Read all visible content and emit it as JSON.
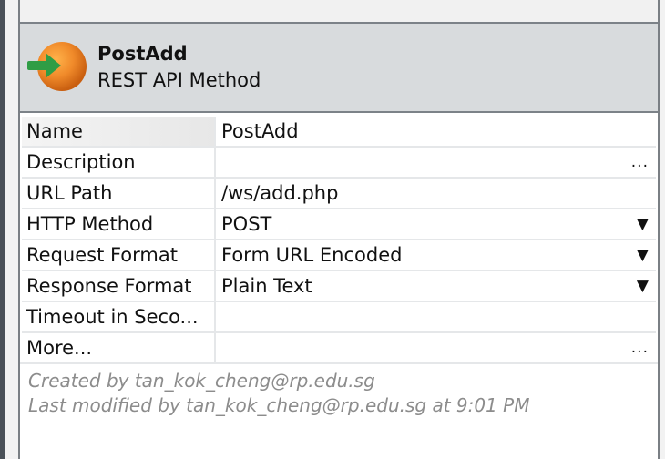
{
  "header": {
    "title": "PostAdd",
    "subtitle": "REST API Method",
    "icon": "rest-method-icon"
  },
  "properties": [
    {
      "name": "Name",
      "value": "PostAdd",
      "suffix": ""
    },
    {
      "name": "Description",
      "value": "",
      "suffix": "..."
    },
    {
      "name": "URL Path",
      "value": "/ws/add.php",
      "suffix": ""
    },
    {
      "name": "HTTP Method",
      "value": "POST",
      "suffix": "▼"
    },
    {
      "name": "Request Format",
      "value": "Form URL Encoded",
      "suffix": "▼"
    },
    {
      "name": "Response Format",
      "value": "Plain Text",
      "suffix": "▼"
    },
    {
      "name": "Timeout in Seco...",
      "value": "",
      "suffix": ""
    },
    {
      "name": "More...",
      "value": "",
      "suffix": "..."
    }
  ],
  "footer": {
    "created_by": "Created by tan_kok_cheng@rp.edu.sg",
    "modified_by": "Last modified by tan_kok_cheng@rp.edu.sg at 9:01 PM"
  },
  "colors": {
    "header_bg": "#d8dbdd",
    "icon_orange": "#f08a2a",
    "icon_arrow": "#2f9d45"
  }
}
